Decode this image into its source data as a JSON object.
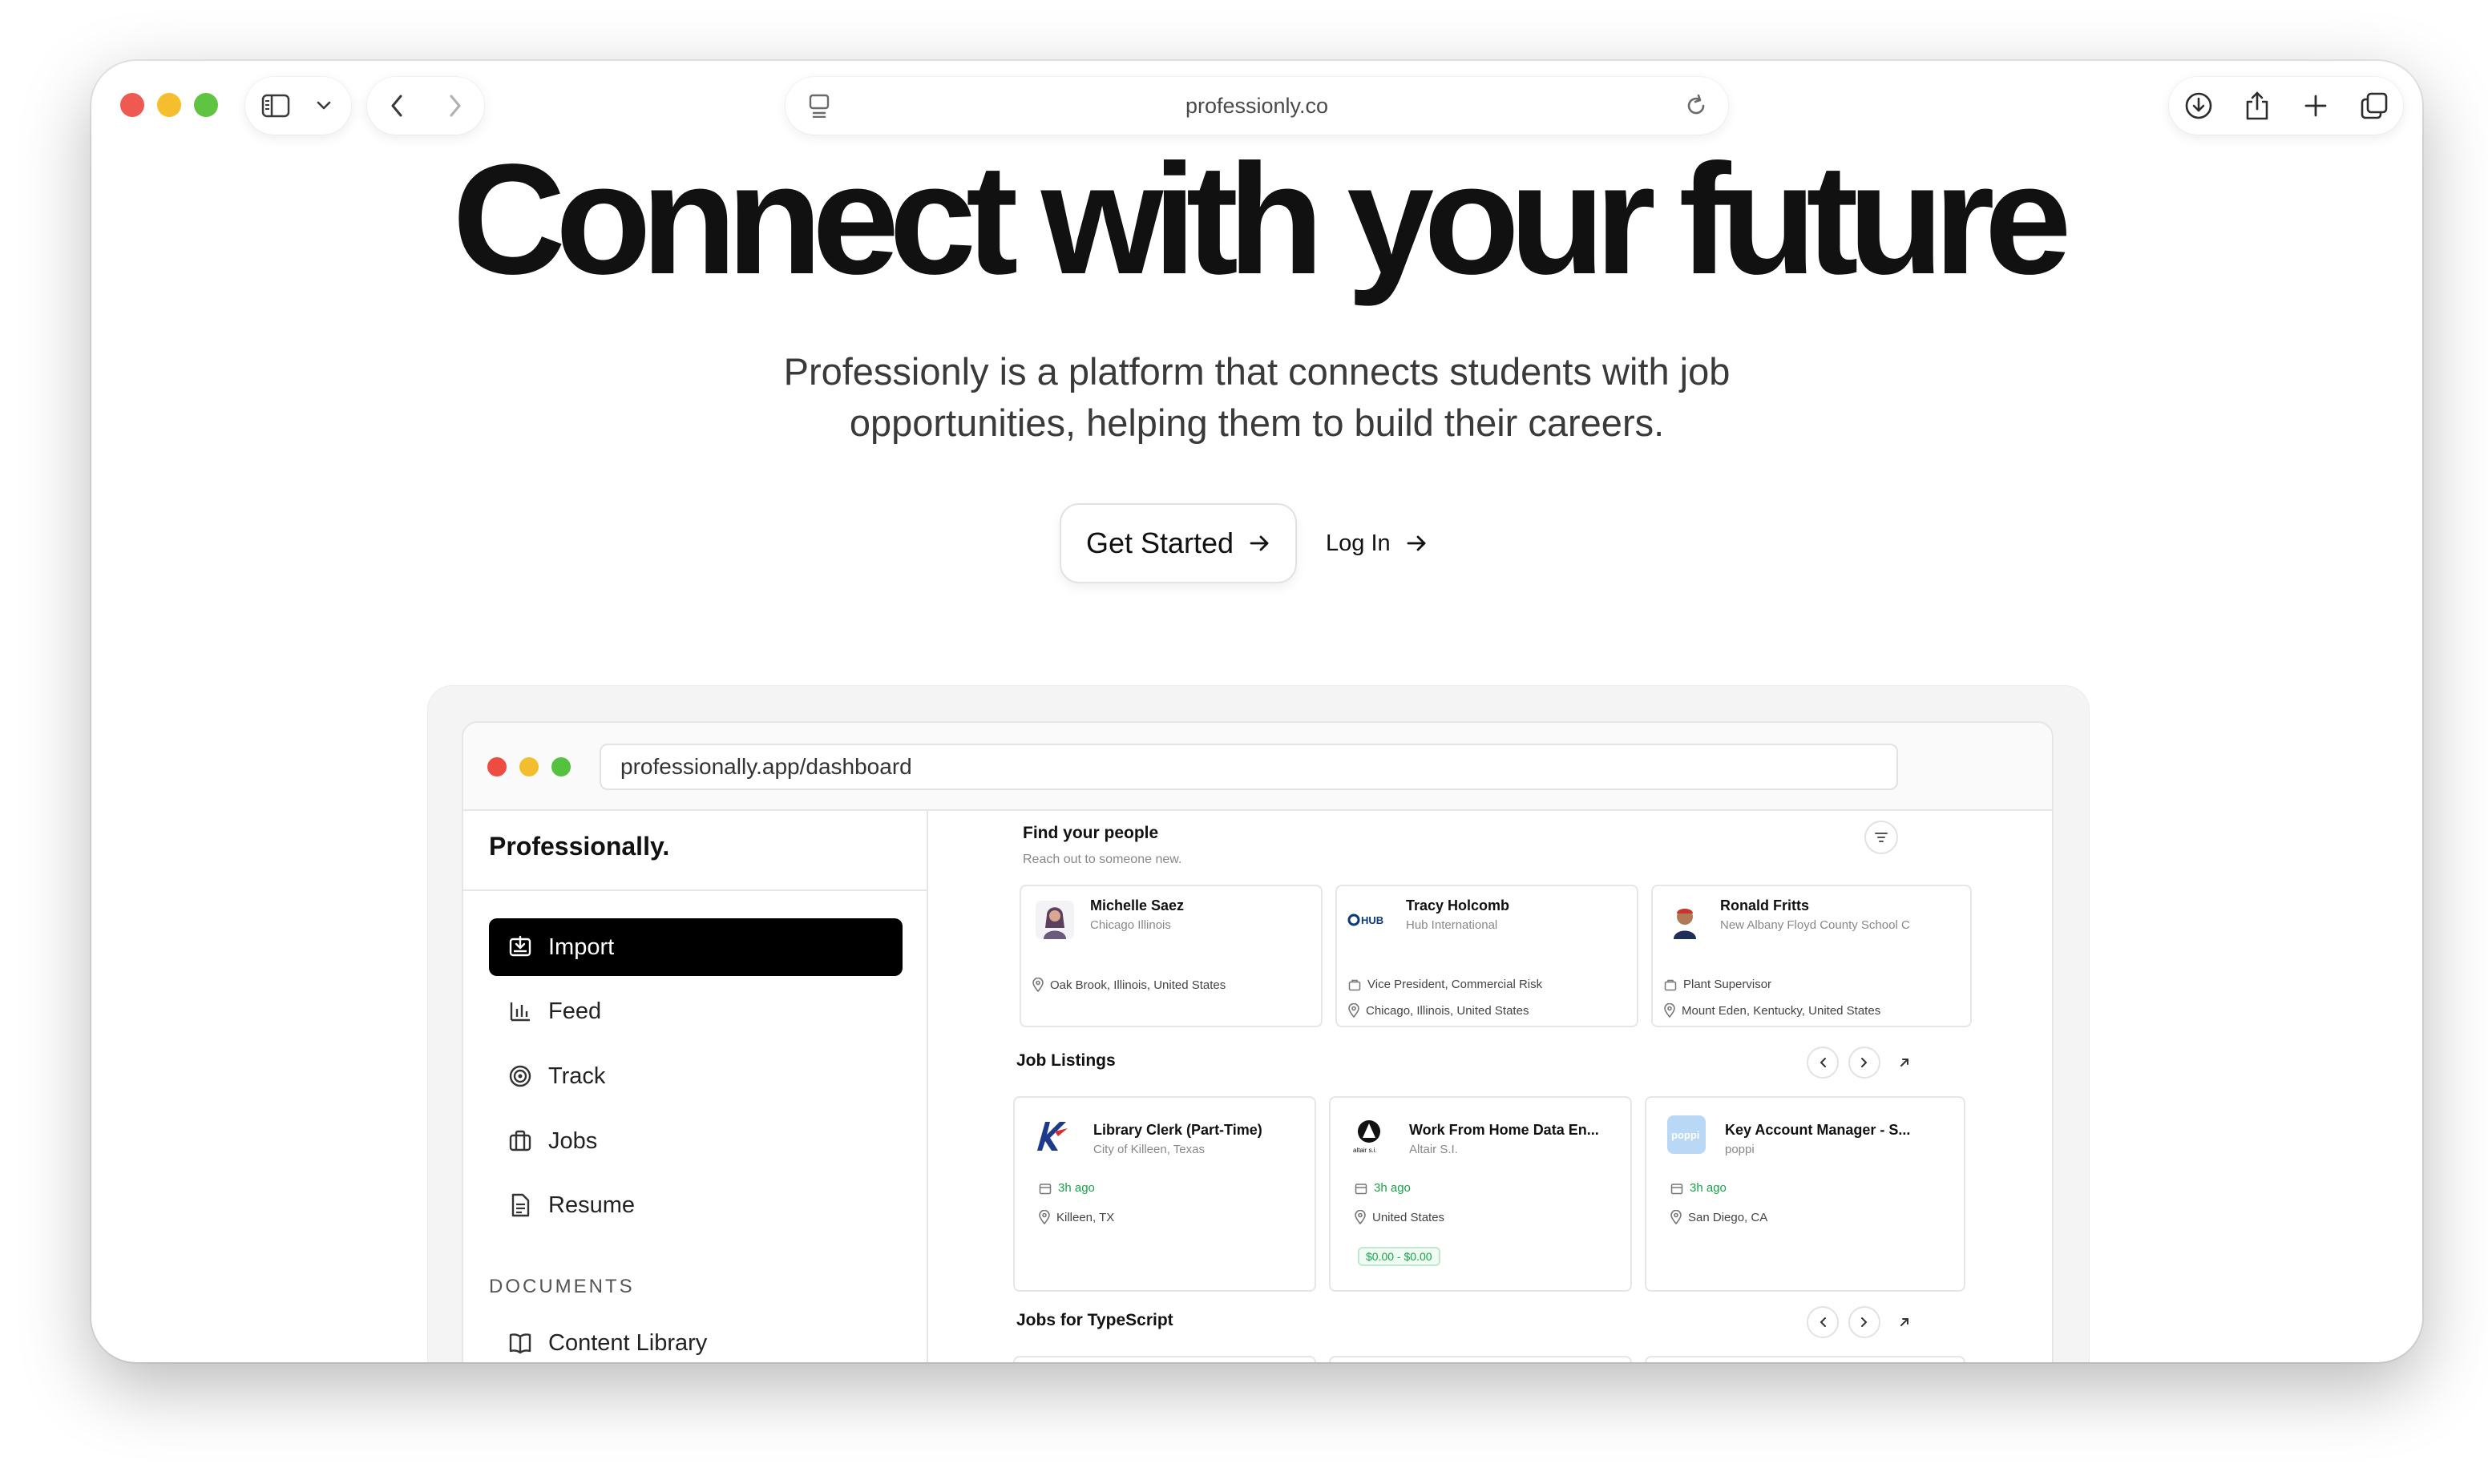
{
  "browser": {
    "url": "professionly.co",
    "icons": [
      "sidebar-icon",
      "chevron-down-icon",
      "back-icon",
      "forward-icon",
      "page-icon",
      "reload-icon",
      "download-icon",
      "share-icon",
      "plus-icon",
      "tabs-icon"
    ]
  },
  "hero": {
    "title": "Connect with your future",
    "subtitle_line1": "Professionly is a platform that connects students with job",
    "subtitle_line2": "opportunities, helping them to build their careers.",
    "get_started": "Get Started",
    "log_in": "Log In"
  },
  "dashboard": {
    "url": "professionally.app/dashboard",
    "brand": "Professionally.",
    "nav": [
      {
        "label": "Import",
        "icon": "import-icon",
        "active": true
      },
      {
        "label": "Feed",
        "icon": "bar-chart-icon",
        "active": false
      },
      {
        "label": "Track",
        "icon": "target-icon",
        "active": false
      },
      {
        "label": "Jobs",
        "icon": "briefcase-icon",
        "active": false
      },
      {
        "label": "Resume",
        "icon": "document-icon",
        "active": false
      }
    ],
    "documents_label": "DOCUMENTS",
    "documents_items": [
      {
        "label": "Content Library",
        "icon": "book-icon"
      }
    ],
    "people": {
      "title": "Find your people",
      "subtitle": "Reach out to someone new.",
      "cards": [
        {
          "name": "Michelle Saez",
          "org": "Chicago Illinois",
          "role": "",
          "location": "Oak Brook, Illinois, United States"
        },
        {
          "name": "Tracy Holcomb",
          "org": "Hub International",
          "role": "Vice President, Commercial Risk",
          "location": "Chicago, Illinois, United States",
          "logo_text": "HUB"
        },
        {
          "name": "Ronald Fritts",
          "org": "New Albany Floyd County School C",
          "role": "Plant Supervisor",
          "location": "Mount Eden, Kentucky, United States"
        }
      ]
    },
    "jobs": {
      "title": "Job Listings",
      "cards": [
        {
          "title": "Library Clerk (Part-Time)",
          "company": "City of Killeen, Texas",
          "posted": "3h ago",
          "location": "Killeen, TX",
          "salary": ""
        },
        {
          "title": "Work From Home Data En...",
          "company": "Altair S.I.",
          "posted": "3h ago",
          "location": "United States",
          "salary": "$0.00 - $0.00",
          "logo_text": "altair s.i."
        },
        {
          "title": "Key Account Manager - S...",
          "company": "poppi",
          "posted": "3h ago",
          "location": "San Diego, CA",
          "salary": "",
          "logo_text": "poppi"
        }
      ]
    },
    "typescript": {
      "title": "Jobs for TypeScript"
    },
    "colors": {
      "active_nav": "#000000",
      "posted_green": "#16a34a"
    }
  }
}
